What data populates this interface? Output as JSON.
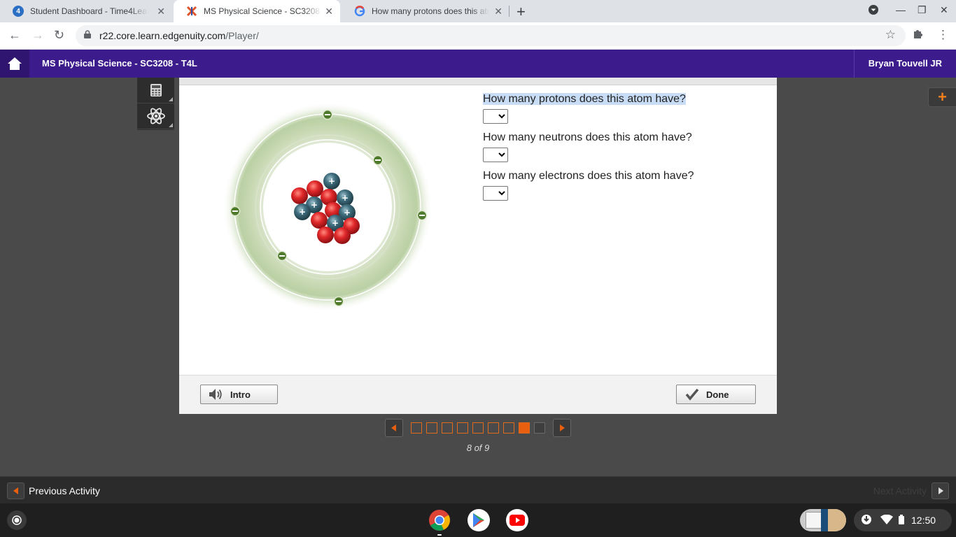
{
  "browser": {
    "tabs": [
      {
        "title": "Student Dashboard - Time4Learning",
        "active": false
      },
      {
        "title": "MS Physical Science - SC3208 - T4L",
        "active": true
      },
      {
        "title": "How many protons does this atom have",
        "active": false
      }
    ],
    "url_host": "r22.core.learn.edgenuity.com",
    "url_path": "/Player/"
  },
  "header": {
    "course_title": "MS Physical Science - SC3208 - T4L",
    "user_name": "Bryan Touvell JR"
  },
  "atom": {
    "protons": 6,
    "neutrons": 7,
    "electrons": 6,
    "shells": 2
  },
  "questions": [
    {
      "text": "How many protons does this atom have?",
      "selected": ""
    },
    {
      "text": "How many neutrons does this atom have?",
      "selected": ""
    },
    {
      "text": "How many electrons does this atom have?",
      "selected": ""
    }
  ],
  "footer": {
    "intro_label": "Intro",
    "done_label": "Done"
  },
  "pager": {
    "current": 8,
    "total": 9,
    "count_text": "8 of 9"
  },
  "activity_bar": {
    "previous_label": "Previous Activity",
    "next_label": "Next Activity"
  },
  "system": {
    "clock": "12:50"
  },
  "colors": {
    "header_purple": "#3c1c8c",
    "proton_red": "#e0282a",
    "neutron_teal": "#3f6e7e",
    "electron_green": "#4f7a2c",
    "pager_orange": "#e8600f"
  }
}
